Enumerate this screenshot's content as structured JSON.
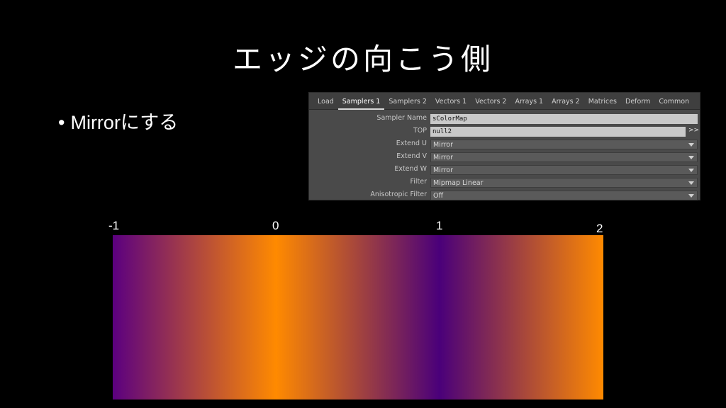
{
  "slide": {
    "title": "エッジの向こう側",
    "bullet": "Mirrorにする"
  },
  "panel": {
    "tabs": [
      "Load",
      "Samplers 1",
      "Samplers 2",
      "Vectors 1",
      "Vectors 2",
      "Arrays 1",
      "Arrays 2",
      "Matrices",
      "Deform",
      "Common"
    ],
    "active_tab": "Samplers 1",
    "params": {
      "sampler_name": {
        "label": "Sampler Name",
        "value": "sColorMap"
      },
      "top": {
        "label": "TOP",
        "value": "null2",
        "jump": ">>"
      },
      "extend_u": {
        "label": "Extend U",
        "value": "Mirror"
      },
      "extend_v": {
        "label": "Extend V",
        "value": "Mirror"
      },
      "extend_w": {
        "label": "Extend W",
        "value": "Mirror"
      },
      "filter": {
        "label": "Filter",
        "value": "Mipmap Linear"
      },
      "anisotropic_filter": {
        "label": "Anisotropic Filter",
        "value": "Off"
      }
    }
  },
  "strip": {
    "ticks": [
      "-1",
      "0",
      "1",
      "2"
    ],
    "colors": {
      "purple": "#5b0080",
      "orange": "#ff8a00"
    }
  }
}
